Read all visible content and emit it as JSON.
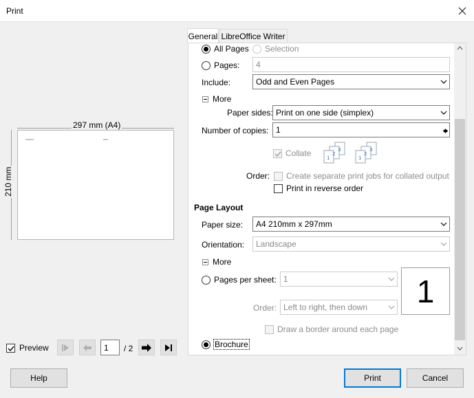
{
  "window": {
    "title": "Print",
    "close_icon": "close-icon"
  },
  "preview": {
    "width_label": "297 mm (A4)",
    "height_label": "210 mm",
    "checkbox_label": "Preview",
    "checkbox_checked": true,
    "page_input": "1",
    "page_total": "/ 2"
  },
  "tabs": [
    {
      "label": "General",
      "active": true
    },
    {
      "label": "LibreOffice Writer",
      "active": false
    }
  ],
  "range": {
    "all_pages": "All Pages",
    "selection": "Selection",
    "pages": "Pages:",
    "pages_value": "4",
    "include_label": "Include:",
    "include_value": "Odd and Even Pages"
  },
  "more1": {
    "label": "More",
    "paper_sides_label": "Paper sides:",
    "paper_sides_value": "Print on one side (simplex)",
    "copies_label": "Number of copies:",
    "copies_value": "1",
    "collate_label": "Collate",
    "order_label": "Order:",
    "separate_jobs": "Create separate print jobs for collated output",
    "reverse_order": "Print in reverse order"
  },
  "layout": {
    "section_title": "Page Layout",
    "paper_size_label": "Paper size:",
    "paper_size_value": "A4 210mm x 297mm",
    "orientation_label": "Orientation:",
    "orientation_value": "Landscape",
    "more_label": "More",
    "pages_per_sheet_label": "Pages per sheet:",
    "pages_per_sheet_value": "1",
    "order_label": "Order:",
    "order_value": "Left to right, then down",
    "sheet_preview_number": "1",
    "border_label": "Draw a border around each page",
    "brochure_label": "Brochure"
  },
  "buttons": {
    "help": "Help",
    "print": "Print",
    "cancel": "Cancel"
  },
  "colors": {
    "accent": "#0078d7",
    "disabled_text": "#8d8d8d"
  }
}
